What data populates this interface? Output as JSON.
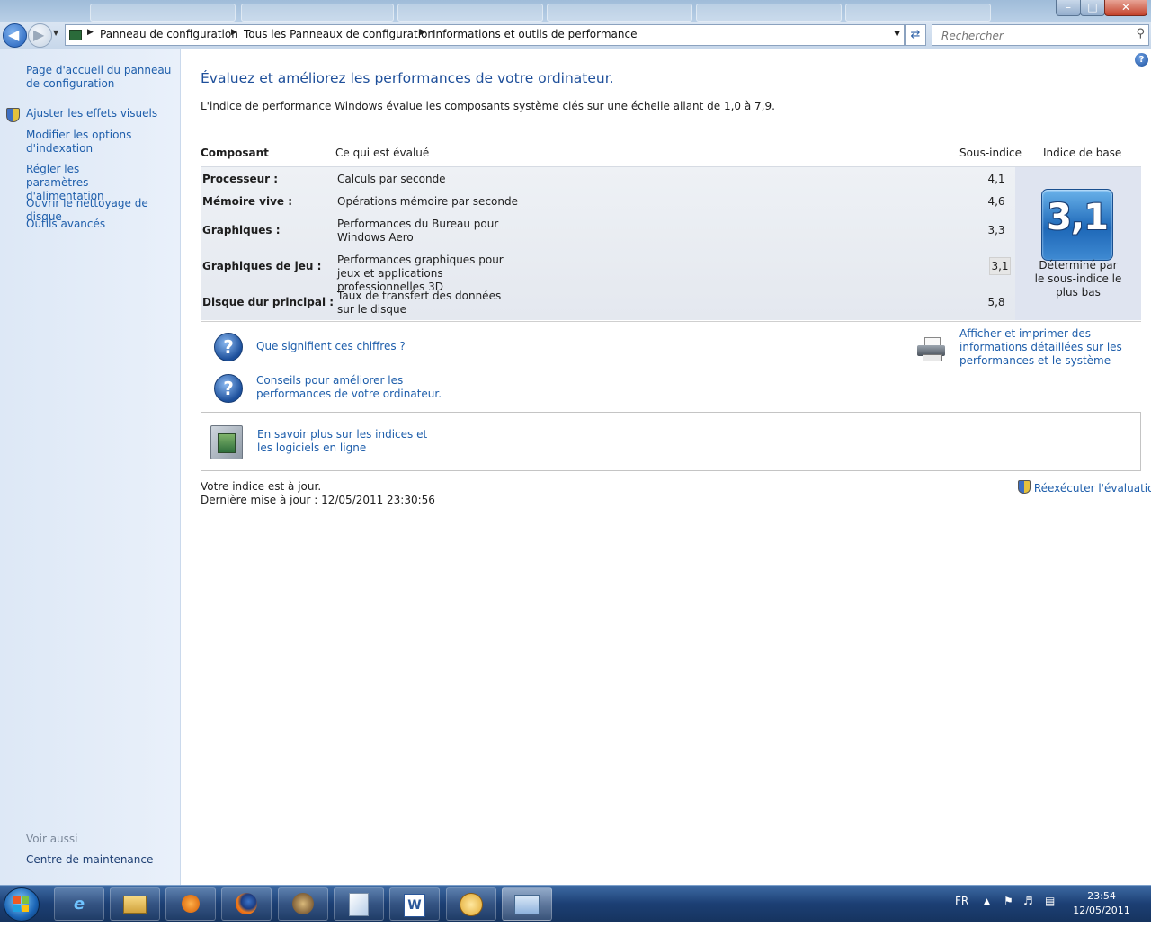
{
  "window": {
    "minimize_label": "–",
    "maximize_label": "□",
    "close_label": "✕"
  },
  "address_bar": {
    "crumbs": [
      "Panneau de configuration",
      "Tous les Panneaux de configuration",
      "Informations et outils de performance"
    ],
    "search_placeholder": "Rechercher"
  },
  "left_pane": {
    "links": [
      "Page d'accueil du panneau de configuration",
      "Ajuster les effets visuels",
      "Modifier les options d'indexation",
      "Régler les paramètres d'alimentation",
      "Ouvrir le nettoyage de disque",
      "Outils avancés"
    ],
    "see_also_label": "Voir aussi",
    "see_also_link": "Centre de maintenance"
  },
  "main": {
    "help_label": "?",
    "heading": "Évaluez et améliorez les performances de votre ordinateur.",
    "intro": "L'indice de performance Windows évalue les composants système clés sur une échelle allant de 1,0 à 7,9.",
    "table": {
      "headers": [
        "Composant",
        "Ce qui est évalué",
        "Sous-indice",
        "Indice de base"
      ],
      "rows": [
        {
          "component": "Processeur :",
          "description": "Calculs par seconde",
          "score": "4,1"
        },
        {
          "component": "Mémoire vive :",
          "description": "Opérations mémoire par seconde",
          "score": "4,6"
        },
        {
          "component": "Graphiques :",
          "description": "Performances du Bureau pour Windows Aero",
          "score": "3,3"
        },
        {
          "component": "Graphiques de jeu :",
          "description": "Performances graphiques pour jeux et applications professionnelles 3D",
          "score": "3,1"
        },
        {
          "component": "Disque dur principal :",
          "description": "Taux de transfert des données sur le disque",
          "score": "5,8"
        }
      ],
      "base_score": "3,1",
      "base_caption": "Déterminé par le sous-indice le plus bas"
    },
    "links": {
      "what_numbers_mean": "Que signifient ces chiffres ?",
      "tips": "Conseils pour améliorer les performances de votre ordinateur.",
      "print_details": "Afficher et imprimer des informations détaillées sur les performances et le système",
      "learn_more": "En savoir plus sur les indices et les logiciels en ligne"
    },
    "status": "Votre indice est à jour.",
    "last_update": "Dernière mise à jour : 12/05/2011 23:30:56",
    "rerun": "Réexécuter l'évaluation"
  },
  "taskbar": {
    "language": "FR",
    "time": "23:54",
    "date": "12/05/2011"
  }
}
